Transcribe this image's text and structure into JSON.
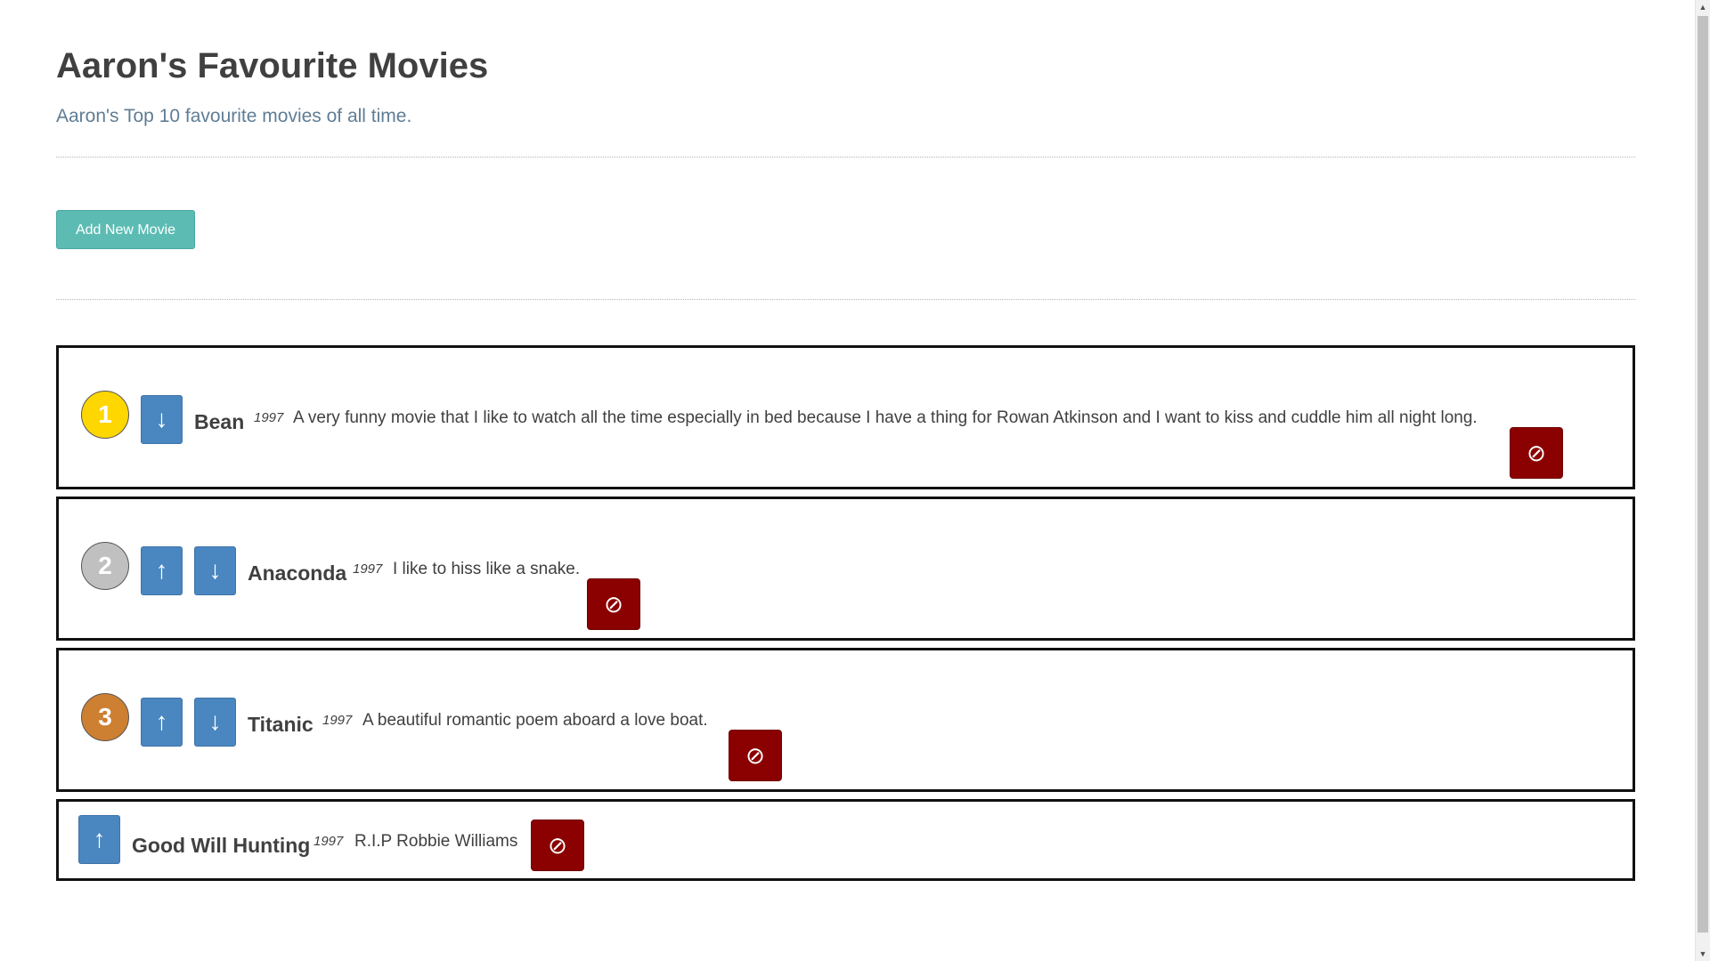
{
  "header": {
    "title": "Aaron's Favourite Movies",
    "subtitle": "Aaron's Top 10 favourite movies of all time."
  },
  "actions": {
    "add_label": "Add New Movie"
  },
  "icons": {
    "up_arrow": "↑",
    "down_arrow": "↓",
    "delete": "⊘",
    "scroll_up": "▲",
    "scroll_down": "▼"
  },
  "colors": {
    "gold": "#ffd700",
    "silver": "#c0c0c0",
    "bronze": "#cd7f32",
    "arrow_button": "#4a86c0",
    "delete_button": "#8b0000",
    "add_button": "#5cbcb4"
  },
  "movies": [
    {
      "rank": "1",
      "title": "Bean",
      "year": "1997",
      "description": "A very funny movie that I like to watch all the time especially in bed because I have a thing for Rowan Atkinson and I want to kiss and cuddle him all night long."
    },
    {
      "rank": "2",
      "title": "Anaconda",
      "year": "1997",
      "description": "I like to hiss like a snake."
    },
    {
      "rank": "3",
      "title": "Titanic",
      "year": "1997",
      "description": "A beautiful romantic poem aboard a love boat."
    },
    {
      "rank": "",
      "title": "Good Will Hunting",
      "year": "1997",
      "description": "R.I.P Robbie Williams"
    }
  ]
}
